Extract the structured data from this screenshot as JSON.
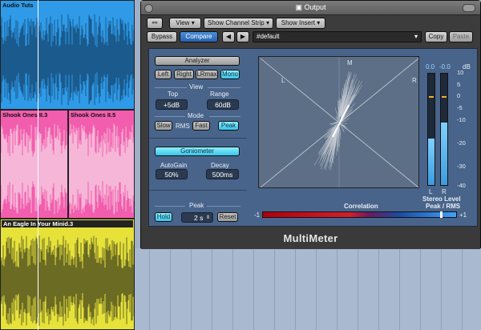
{
  "tracks": [
    {
      "name": "Audio Tuts",
      "color": "#2f9be8",
      "wave": "#1a5a8c"
    },
    {
      "name": "Shook Ones II.3",
      "color": "#f25dad",
      "wave": "#f6b6d8"
    },
    {
      "name": "Shook Ones II.5",
      "color": "#f25dad",
      "wave": "#f6b6d8"
    },
    {
      "name": "An Eagle In Your Minid.3",
      "color": "#e6e23a",
      "wave": "#6b6b24"
    }
  ],
  "window": {
    "title": "Output"
  },
  "toolbar": {
    "view": "View",
    "show_channel_strip": "Show Channel Strip",
    "show_insert": "Show Insert",
    "bypass": "Bypass",
    "compare": "Compare",
    "prev": "◀",
    "next": "▶",
    "preset": "#default",
    "copy": "Copy",
    "paste": "Paste"
  },
  "analyzer": {
    "analyzer": "Analyzer",
    "left": "Left",
    "right": "Right",
    "lrmax": "LRmax",
    "mono": "Mono",
    "view": "View",
    "top_label": "Top",
    "top_value": "+5dB",
    "range_label": "Range",
    "range_value": "60dB",
    "mode": "Mode",
    "slow": "Slow",
    "rms": "RMS",
    "fast": "Fast",
    "peak": "Peak"
  },
  "gonio": {
    "label": "Goniometer",
    "autogain_label": "AutoGain",
    "autogain_value": "50%",
    "decay_label": "Decay",
    "decay_value": "500ms"
  },
  "peak": {
    "label": "Peak",
    "hold": "Hold",
    "time": "2 s",
    "reset": "Reset"
  },
  "scope": {
    "m": "M",
    "l": "L",
    "r": "R"
  },
  "correlation": {
    "label": "Correlation",
    "minus": "-1",
    "plus": "+1",
    "value": 0.85
  },
  "levels": {
    "left_peak": "0.0",
    "right_peak": "-0.0",
    "db_unit": "dB",
    "scale": [
      "10",
      "5",
      "0",
      "-5",
      "-10",
      "-20",
      "-30",
      "-40"
    ],
    "meter_l": "L",
    "meter_r": "R",
    "stereo_level": "Stereo Level",
    "peak_rms": "Peak / RMS",
    "left_level": 0.42,
    "right_level": 0.56
  },
  "footer": {
    "name": "MultiMeter"
  }
}
